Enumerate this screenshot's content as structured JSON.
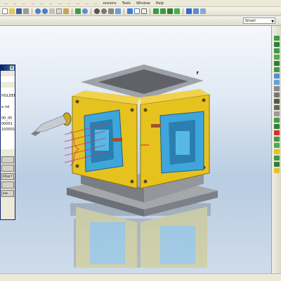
{
  "menubar": {
    "items": [
      "...",
      "...",
      "...",
      "...",
      "...",
      "...",
      "...",
      "...",
      "...",
      "...",
      "...",
      "ensions",
      "Tools",
      "Window",
      "Help"
    ]
  },
  "toolbar": {
    "filter_value": "Smart"
  },
  "dialog": {
    "rows": [
      "",
      "",
      "",
      "",
      "HOLDER",
      "",
      "e rid",
      "",
      "00_00",
      "00001",
      "100001",
      "",
      "",
      "",
      "",
      "",
      "",
      "",
      "",
      "",
      "",
      ""
    ],
    "buttons": [
      "",
      "",
      "hTool.f",
      "",
      "ose"
    ]
  },
  "colors": {
    "fixture_yellow": "#e6c21f",
    "part_blue": "#3ea6db",
    "base_gray": "#8a8d92",
    "viewport_bg_top": "#f5f8fc",
    "viewport_bg_bottom": "#b8cce2",
    "dialog_title": "#0a246a"
  },
  "icons": {
    "toolbar": [
      "new-icon",
      "open-icon",
      "save-icon",
      "print-icon",
      "undo-icon",
      "redo-icon",
      "cut-icon",
      "copy-icon",
      "paste-icon",
      "regen-icon",
      "search-icon",
      "zoom-in-icon",
      "zoom-out-icon",
      "refit-icon",
      "orient-icon",
      "shade-icon",
      "wireframe-icon",
      "hidden-line-icon",
      "datum-plane-icon",
      "datum-axis-icon",
      "datum-point-icon",
      "csys-icon",
      "play-path-icon",
      "toolpath-icon",
      "mfg-param-icon"
    ],
    "right": [
      "mill-volume-icon",
      "mill-surface-icon",
      "mill-window-icon",
      "face-milling-icon",
      "profile-milling-icon",
      "pocket-icon",
      "trajectory-icon",
      "drill-icon",
      "thread-icon",
      "contour-icon",
      "engrave-icon",
      "axis-icon",
      "point-icon",
      "plane-icon",
      "sketch-icon",
      "csys-icon",
      "curve-icon",
      "round-icon",
      "chamfer-icon",
      "mirror-icon",
      "pattern-icon",
      "text-icon"
    ]
  }
}
